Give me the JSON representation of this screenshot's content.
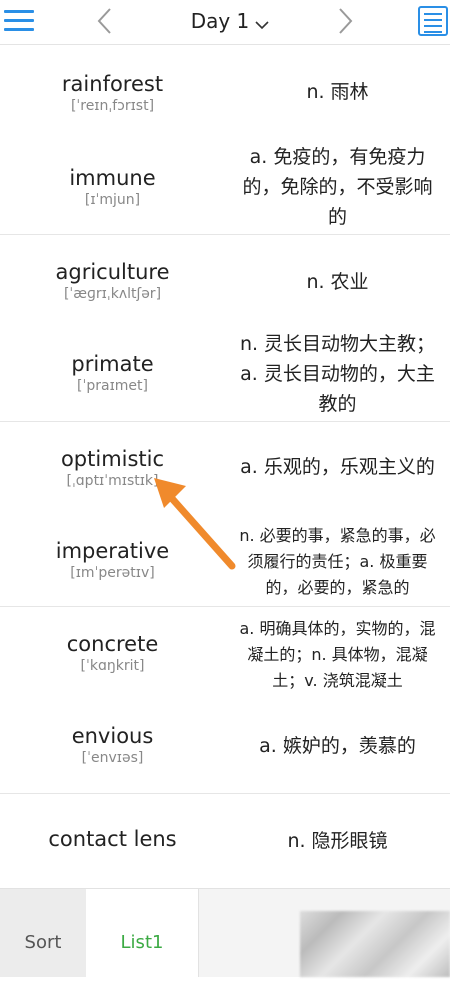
{
  "header": {
    "day_label": "Day 1"
  },
  "words": [
    {
      "en": "rainforest",
      "ph": "[ˈreɪnˌfɔrɪst]",
      "meaning": "n. 雨林"
    },
    {
      "en": "immune",
      "ph": "[ɪˈmjun]",
      "meaning": "a. 免疫的，有免疫力的，免除的，不受影响的"
    },
    {
      "en": "agriculture",
      "ph": "[ˈæɡrɪˌkʌltʃər]",
      "meaning": "n. 农业"
    },
    {
      "en": "primate",
      "ph": "[ˈpraɪmet]",
      "meaning": "n. 灵长目动物大主教；a. 灵长目动物的，大主教的"
    },
    {
      "en": "optimistic",
      "ph": "[ˌɑptɪˈmɪstɪk]",
      "meaning": "a. 乐观的，乐观主义的"
    },
    {
      "en": "imperative",
      "ph": "[ɪmˈperətɪv]",
      "meaning": "n. 必要的事，紧急的事，必须履行的责任；a. 极重要的，必要的，紧急的"
    },
    {
      "en": "concrete",
      "ph": "[ˈkɑŋkrit]",
      "meaning": "a. 明确具体的，实物的，混凝土的；n. 具体物，混凝土；v. 浇筑混凝土"
    },
    {
      "en": "envious",
      "ph": "[ˈenvɪəs]",
      "meaning": "a. 嫉妒的，羡慕的"
    },
    {
      "en": "contact lens",
      "ph": "",
      "meaning": "n. 隐形眼镜"
    }
  ],
  "bottom_tabs": {
    "sort_label": "Sort",
    "list1_label": "List1"
  },
  "colors": {
    "accent_blue": "#2a8fe6",
    "active_tab_green": "#3caa44",
    "arrow_orange": "#f08a2c"
  }
}
